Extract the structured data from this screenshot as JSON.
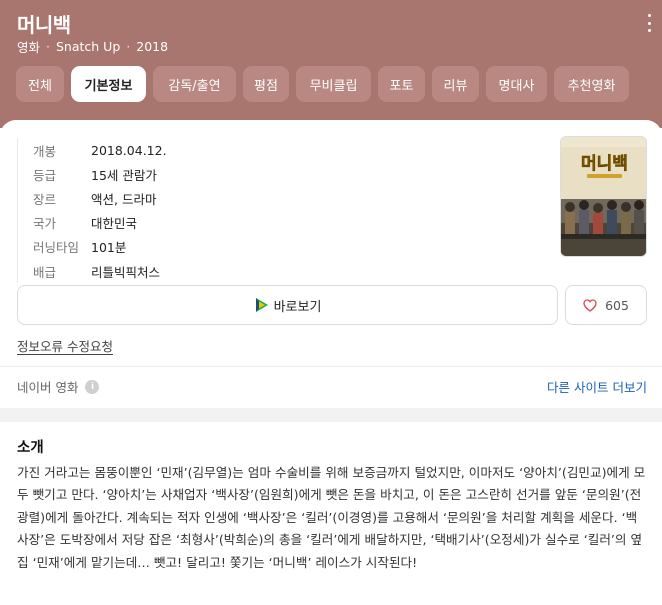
{
  "header": {
    "title": "머니백",
    "meta": [
      "영화",
      "Snatch Up",
      "2018"
    ]
  },
  "tabs": [
    {
      "label": "전체",
      "active": false
    },
    {
      "label": "기본정보",
      "active": true
    },
    {
      "label": "감독/출연",
      "active": false
    },
    {
      "label": "평점",
      "active": false
    },
    {
      "label": "무비클립",
      "active": false
    },
    {
      "label": "포토",
      "active": false
    },
    {
      "label": "리뷰",
      "active": false
    },
    {
      "label": "명대사",
      "active": false
    },
    {
      "label": "추천영화",
      "active": false
    }
  ],
  "info": [
    {
      "key": "개봉",
      "value": "2018.04.12."
    },
    {
      "key": "등급",
      "value": "15세 관람가"
    },
    {
      "key": "장르",
      "value": "액션, 드라마"
    },
    {
      "key": "국가",
      "value": "대한민국"
    },
    {
      "key": "러닝타임",
      "value": "101분"
    },
    {
      "key": "배급",
      "value": "리틀빅픽처스"
    }
  ],
  "poster": {
    "title": "머니백"
  },
  "actions": {
    "watch_label": "바로보기",
    "like_count": "605"
  },
  "report_link": "정보오류 수정요청",
  "source": {
    "label": "네이버 영화",
    "more_link": "다른 사이트 더보기"
  },
  "intro": {
    "heading": "소개",
    "body": "가진 거라고는 몸뚱이뿐인 ‘민재’(김무열)는 엄마 수술비를 위해 보증금까지 털었지만, 이마저도 ‘양아치’(김민교)에게 모두 뺏기고 만다. ‘양아치’는 사채업자 ‘백사장’(임원희)에게 뺏은 돈을 바치고, 이 돈은 고스란히 선거를 앞둔 ‘문의원’(전광렬)에게 돌아간다. 계속되는 적자 인생에 ‘백사장’은 ‘킬러’(이경영)를 고용해서 ‘문의원’을 처리할 계획을 세운다. ‘백사장’은 도박장에서 저당 잡은 ‘최형사’(박희순)의 총을 ‘킬러’에게 배달하지만, ‘택배기사’(오정세)가 실수로 ‘킬러’의 옆집 ‘민재’에게 맡기는데… 뺏고! 달리고! 쫓기는 ‘머니백’ 레이스가 시작된다!"
  },
  "colors": {
    "hero_bg": "#a9756f",
    "tab_bg": "#b98882",
    "link_blue": "#1a5fb4"
  },
  "icons": [
    "more-vertical-icon",
    "play-icon",
    "heart-icon",
    "info-icon"
  ]
}
